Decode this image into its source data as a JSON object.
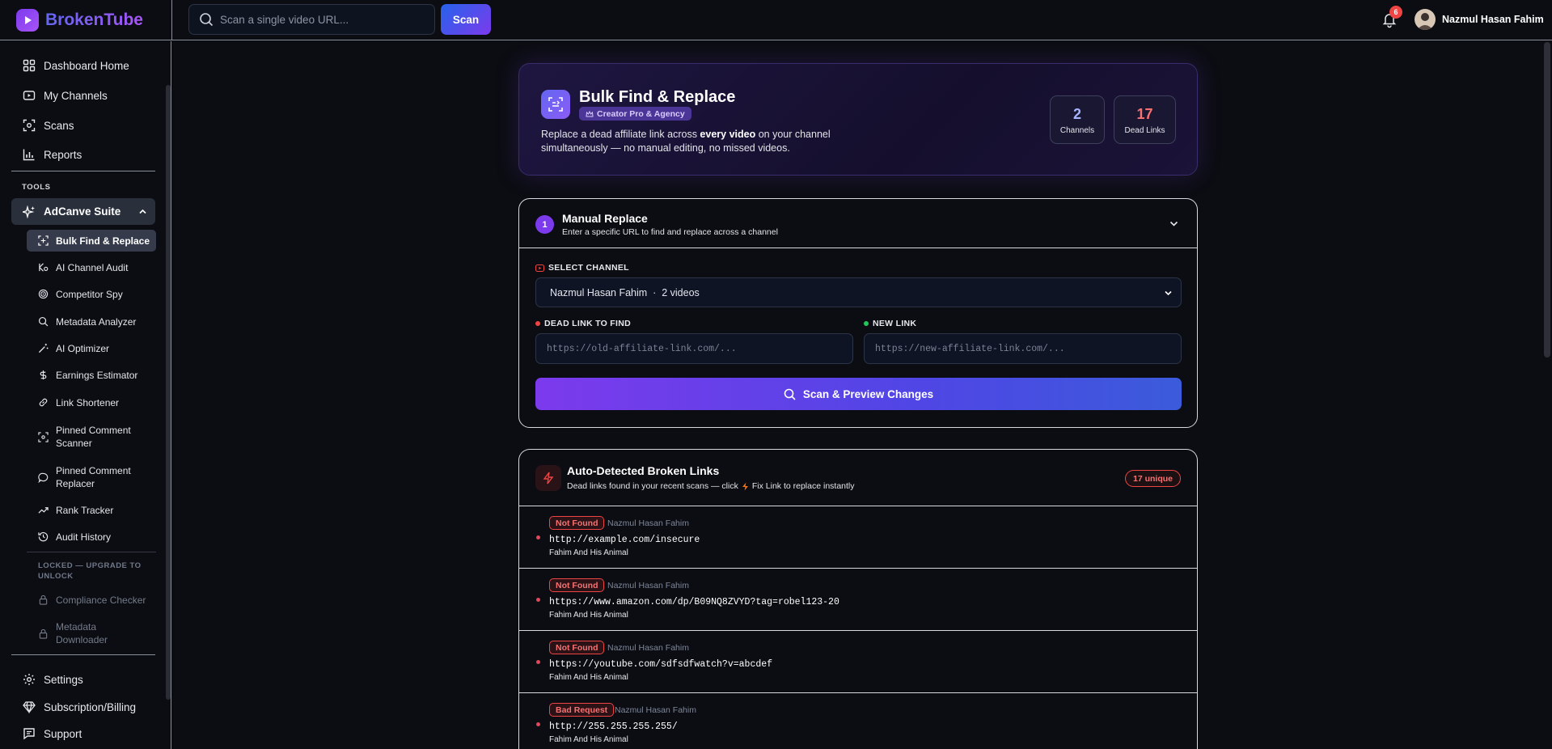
{
  "app": {
    "name": "BrokenTube"
  },
  "topbar": {
    "search_placeholder": "Scan a single video URL...",
    "scan_label": "Scan",
    "notifications": "6",
    "user_name": "Nazmul Hasan Fahim"
  },
  "sidebar": {
    "main": [
      "Dashboard Home",
      "My Channels",
      "Scans",
      "Reports"
    ],
    "tools_label": "TOOLS",
    "suite_label": "AdCanve Suite",
    "suite_items": [
      "Bulk Find & Replace",
      "AI Channel Audit",
      "Competitor Spy",
      "Metadata Analyzer",
      "AI Optimizer",
      "Earnings Estimator",
      "Link Shortener",
      "Pinned Comment Scanner",
      "Pinned Comment Replacer",
      "Rank Tracker",
      "Audit History"
    ],
    "locked_label": "LOCKED — UPGRADE TO UNLOCK",
    "locked_items": [
      "Compliance Checker",
      "Metadata Downloader"
    ],
    "bottom": [
      "Settings",
      "Subscription/Billing",
      "Support"
    ]
  },
  "hero": {
    "title": "Bulk Find & Replace",
    "badge": "Creator Pro & Agency",
    "desc_pre": "Replace a dead affiliate link across ",
    "desc_bold": "every video",
    "desc_post": " on your channel simultaneously — no manual editing, no missed videos.",
    "stats": [
      {
        "value": "2",
        "label": "Channels",
        "color": "#a5b4fc"
      },
      {
        "value": "17",
        "label": "Dead Links",
        "color": "#f87171"
      }
    ]
  },
  "manual": {
    "step": "1",
    "title": "Manual Replace",
    "subtitle": "Enter a specific URL to find and replace across a channel",
    "channel_label": "SELECT CHANNEL",
    "channel_value": "Nazmul Hasan Fahim  ·  2 videos",
    "dead_label": "DEAD LINK TO FIND",
    "dead_placeholder": "https://old-affiliate-link.com/...",
    "new_label": "NEW LINK",
    "new_placeholder": "https://new-affiliate-link.com/...",
    "button": "Scan & Preview Changes"
  },
  "broken": {
    "title": "Auto-Detected Broken Links",
    "subtitle_pre": "Dead links found in your recent scans — click",
    "subtitle_post": "Fix Link to replace instantly",
    "unique": "17 unique",
    "rows": [
      {
        "status": "Not Found",
        "channel": "Nazmul Hasan Fahim",
        "url": "http://example.com/insecure",
        "video": "Fahim And His Animal"
      },
      {
        "status": "Not Found",
        "channel": "Nazmul Hasan Fahim",
        "url": "https://www.amazon.com/dp/B09NQ8ZVYD?tag=robel123-20",
        "video": "Fahim And His Animal"
      },
      {
        "status": "Not Found",
        "channel": "Nazmul Hasan Fahim",
        "url": "https://youtube.com/sdfsdfwatch?v=abcdef",
        "video": "Fahim And His Animal"
      },
      {
        "status": "Bad Request",
        "channel": "Nazmul Hasan Fahim",
        "url": "http://255.255.255.255/",
        "video": "Fahim And His Animal"
      }
    ]
  },
  "colors": {
    "accent": "#7c3aed",
    "danger": "#ef4444",
    "bg": "#0b0d12"
  }
}
